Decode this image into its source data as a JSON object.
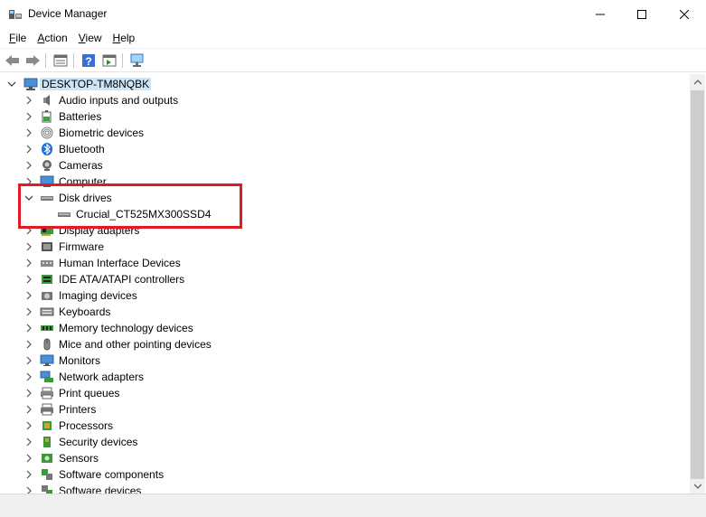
{
  "window": {
    "title": "Device Manager",
    "icon": "device-manager-icon"
  },
  "menu": [
    {
      "label": "File",
      "accel": "F",
      "rest": "ile"
    },
    {
      "label": "Action",
      "accel": "A",
      "rest": "ction"
    },
    {
      "label": "View",
      "accel": "V",
      "rest": "iew"
    },
    {
      "label": "Help",
      "accel": "H",
      "rest": "elp"
    }
  ],
  "tree": {
    "root": "DESKTOP-TM8NQBK",
    "categories": [
      {
        "label": "Audio inputs and outputs",
        "icon": "speaker-icon"
      },
      {
        "label": "Batteries",
        "icon": "battery-icon"
      },
      {
        "label": "Biometric devices",
        "icon": "fingerprint-icon"
      },
      {
        "label": "Bluetooth",
        "icon": "bluetooth-icon"
      },
      {
        "label": "Cameras",
        "icon": "camera-icon"
      },
      {
        "label": "Computer",
        "icon": "computer-icon"
      },
      {
        "label": "Disk drives",
        "icon": "disk-drive-icon",
        "expanded": true,
        "children": [
          "Crucial_CT525MX300SSD4"
        ]
      },
      {
        "label": "Display adapters",
        "icon": "display-adapter-icon"
      },
      {
        "label": "Firmware",
        "icon": "firmware-icon"
      },
      {
        "label": "Human Interface Devices",
        "icon": "hid-icon"
      },
      {
        "label": "IDE ATA/ATAPI controllers",
        "icon": "ide-controller-icon"
      },
      {
        "label": "Imaging devices",
        "icon": "imaging-device-icon"
      },
      {
        "label": "Keyboards",
        "icon": "keyboard-icon"
      },
      {
        "label": "Memory technology devices",
        "icon": "memory-icon"
      },
      {
        "label": "Mice and other pointing devices",
        "icon": "mouse-icon"
      },
      {
        "label": "Monitors",
        "icon": "monitor-icon"
      },
      {
        "label": "Network adapters",
        "icon": "network-adapter-icon"
      },
      {
        "label": "Print queues",
        "icon": "print-queue-icon"
      },
      {
        "label": "Printers",
        "icon": "printer-icon"
      },
      {
        "label": "Processors",
        "icon": "processor-icon"
      },
      {
        "label": "Security devices",
        "icon": "security-device-icon"
      },
      {
        "label": "Sensors",
        "icon": "sensor-icon"
      },
      {
        "label": "Software components",
        "icon": "software-component-icon"
      },
      {
        "label": "Software devices",
        "icon": "software-device-icon"
      }
    ]
  },
  "colors": {
    "highlight": "#e01b24",
    "selection": "#cce4f7"
  }
}
